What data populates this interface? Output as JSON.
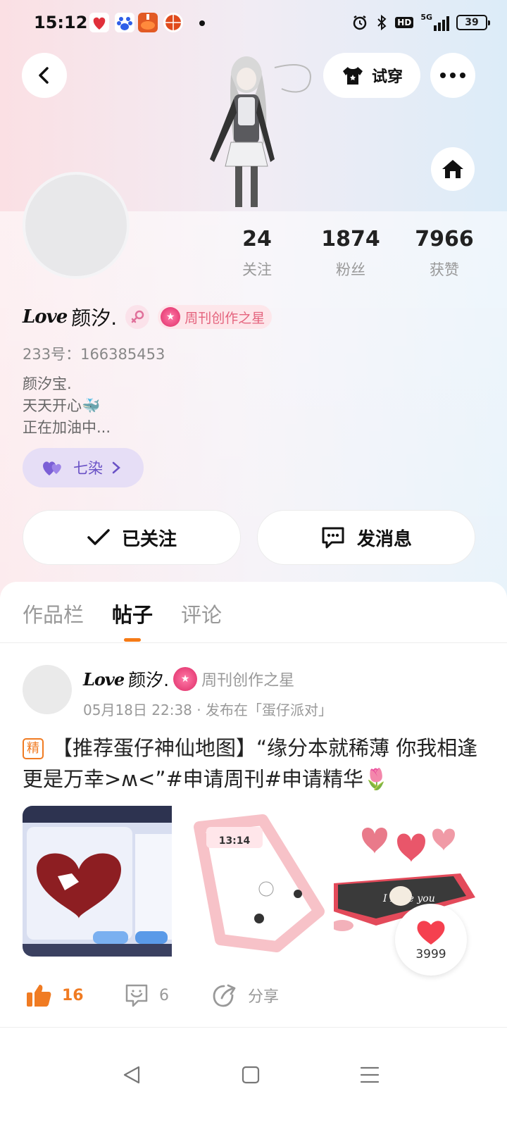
{
  "status_bar": {
    "time": "15:12",
    "battery": "39",
    "network": "5G",
    "hd": "HD"
  },
  "header": {
    "try_on_label": "试穿"
  },
  "profile": {
    "stats": [
      {
        "value": "24",
        "label": "关注"
      },
      {
        "value": "1874",
        "label": "粉丝"
      },
      {
        "value": "7966",
        "label": "获赞"
      }
    ],
    "name_prefix": "Love",
    "nickname": "颜汐.",
    "honor_badge": "周刊创作之星",
    "uid": "233号：166385453",
    "bio_lines": [
      "颜汐宝.",
      "天天开心🐳",
      "正在加油中..."
    ],
    "group_tag": "七染",
    "follow_label": "已关注",
    "message_label": "发消息"
  },
  "tabs": [
    {
      "label": "作品栏"
    },
    {
      "label": "帖子"
    },
    {
      "label": "评论"
    }
  ],
  "post": {
    "author_prefix": "Love",
    "author_name": "颜汐.",
    "author_badge": "周刊创作之星",
    "meta": "05月18日 22:38 · 发布在「蛋仔派对」",
    "essence_tag": "精",
    "content": "【推荐蛋仔神仙地图】“缘分本就稀薄 你我相逢更是万幸>ʍ<”#申请周刊#申请精华🌷",
    "thumb2_time": "13:14",
    "thumb3_text": "I Love you",
    "heart_count": "3999",
    "likes": "16",
    "comments": "6",
    "share_label": "分享"
  },
  "colors": {
    "accent": "#f57a16",
    "badge_pink": "#e4637d",
    "group_purple": "#6a52c6"
  }
}
